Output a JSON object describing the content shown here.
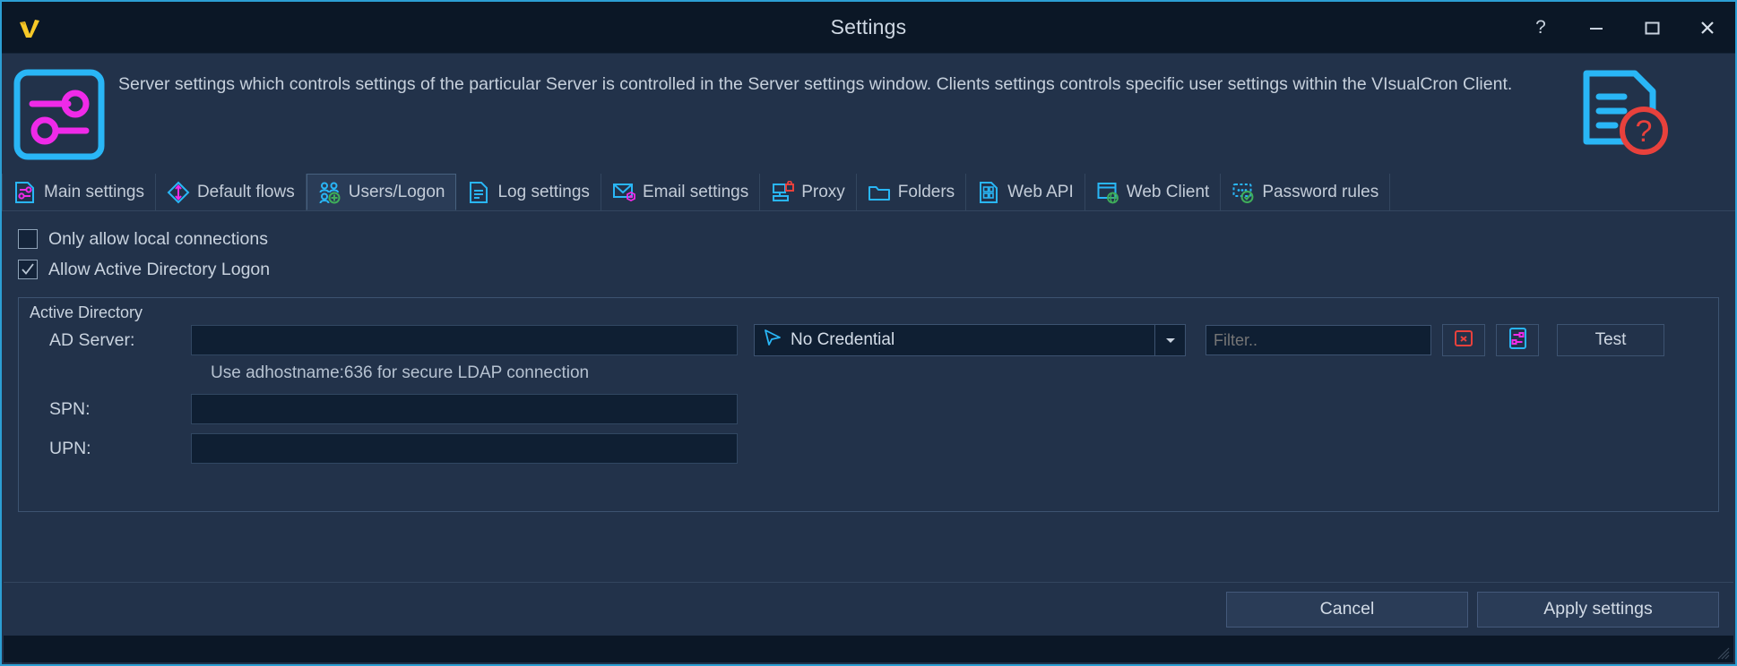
{
  "window": {
    "title": "Settings",
    "logo_icon": "visualcron-logo-icon",
    "controls": [
      {
        "name": "help-button",
        "icon": "question-mark-icon",
        "label": "?"
      },
      {
        "name": "minimize-button",
        "icon": "minimize-icon",
        "label": "–"
      },
      {
        "name": "maximize-button",
        "icon": "maximize-icon",
        "label": "❐"
      },
      {
        "name": "close-button",
        "icon": "close-icon",
        "label": "✕"
      }
    ]
  },
  "header": {
    "icon": "settings-sliders-icon",
    "help_icon": "document-help-icon",
    "description": "Server settings which controls settings of the particular Server is controlled in the Server settings window. Clients settings controls specific user settings within the VIsualCron Client."
  },
  "tabs": [
    {
      "label": "Main settings",
      "icon": "sliders-document-icon",
      "active": false
    },
    {
      "label": "Default flows",
      "icon": "diamond-arrows-icon",
      "active": false
    },
    {
      "label": "Users/Logon",
      "icon": "users-add-icon",
      "active": true
    },
    {
      "label": "Log settings",
      "icon": "log-document-icon",
      "active": false
    },
    {
      "label": "Email settings",
      "icon": "envelope-gear-icon",
      "active": false
    },
    {
      "label": "Proxy",
      "icon": "server-lock-icon",
      "active": false
    },
    {
      "label": "Folders",
      "icon": "folder-icon",
      "active": false
    },
    {
      "label": "Web API",
      "icon": "api-document-icon",
      "active": false
    },
    {
      "label": "Web Client",
      "icon": "browser-globe-icon",
      "active": false
    },
    {
      "label": "Password rules",
      "icon": "password-check-icon",
      "active": false
    }
  ],
  "form": {
    "checkboxes": [
      {
        "label": "Only allow local connections",
        "checked": false
      },
      {
        "label": "Allow Active Directory Logon",
        "checked": true
      }
    ],
    "group": {
      "title": "Active Directory",
      "ad_server": {
        "label": "AD Server:",
        "value": "",
        "placeholder": ""
      },
      "credential": {
        "value": "No Credential",
        "icon": "cursor-arrow-icon",
        "arrow_icon": "chevron-down-icon"
      },
      "filter": {
        "value": "",
        "placeholder": "Filter.."
      },
      "clear_button": {
        "name": "clear-credential-button",
        "icon": "red-delete-icon"
      },
      "edit_button": {
        "name": "edit-credential-button",
        "icon": "sliders-edit-icon"
      },
      "test_button": {
        "label": "Test"
      },
      "hint": "Use adhostname:636 for secure LDAP connection",
      "spn": {
        "label": "SPN:",
        "value": ""
      },
      "upn": {
        "label": "UPN:",
        "value": ""
      }
    }
  },
  "footer": {
    "cancel_label": "Cancel",
    "apply_label": "Apply settings"
  },
  "colors": {
    "window_bg": "#22324a",
    "titlebar_bg": "#0b1726",
    "accent_cyan": "#29b6f6",
    "accent_magenta": "#ef2ae8",
    "field_bg": "#0f1f33",
    "border": "#3d5371",
    "text": "#c9d3df",
    "logo_yellow": "#f7c927",
    "danger_red": "#e8413c",
    "green": "#3fae5a"
  }
}
